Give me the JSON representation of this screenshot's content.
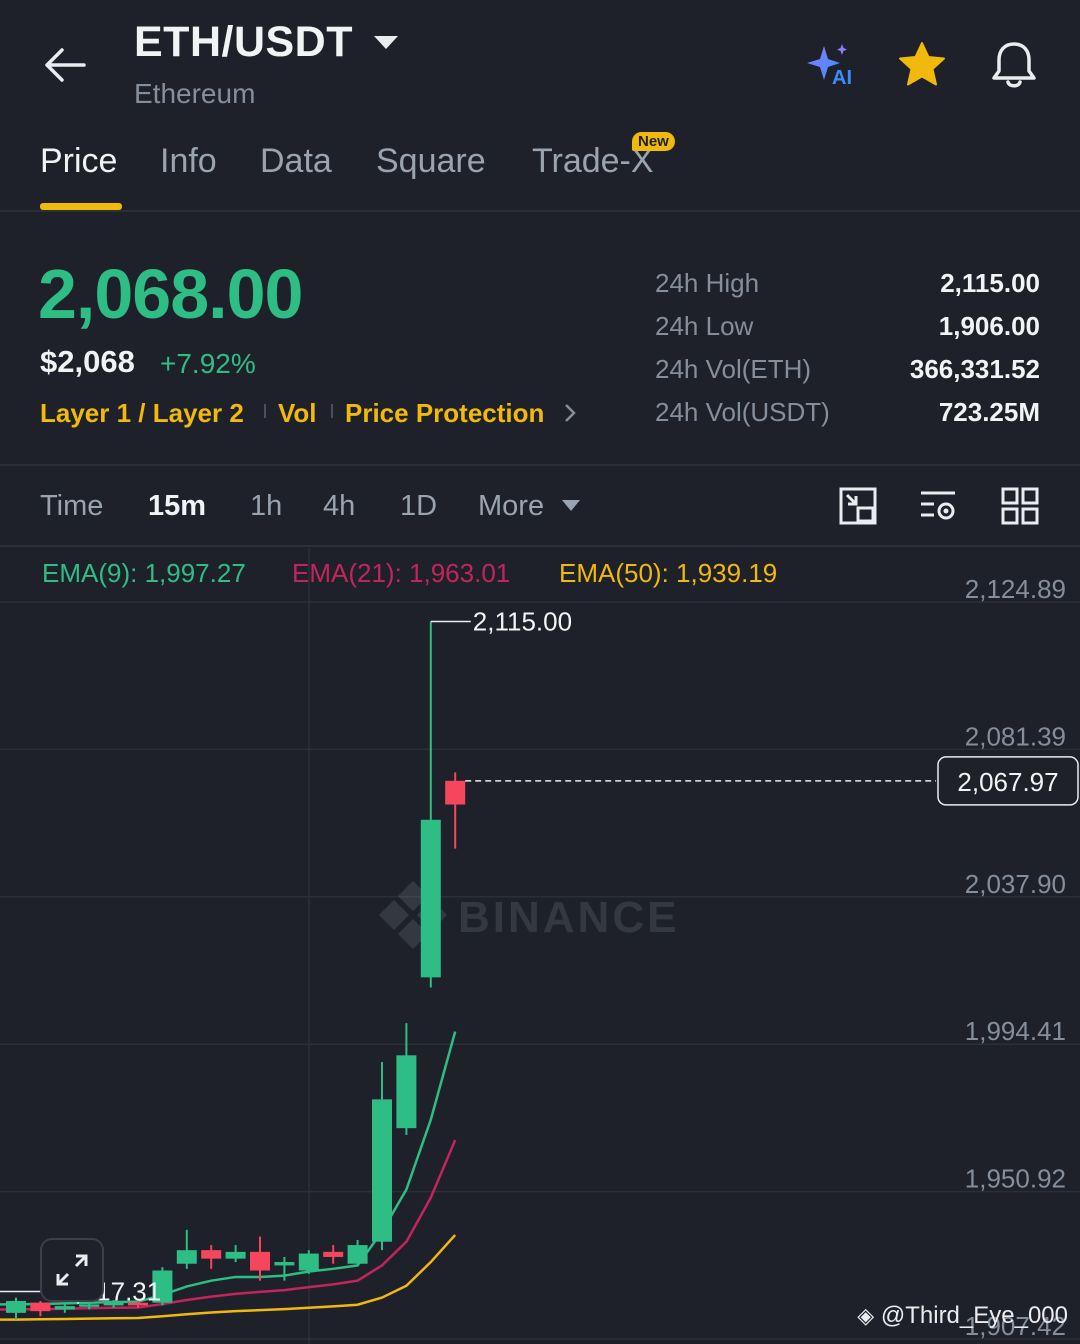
{
  "header": {
    "pair": "ETH/USDT",
    "name": "Ethereum"
  },
  "tabs": [
    {
      "label": "Price",
      "active": true
    },
    {
      "label": "Info"
    },
    {
      "label": "Data"
    },
    {
      "label": "Square"
    },
    {
      "label": "Trade-X",
      "badge": "New"
    }
  ],
  "price": {
    "last": "2,068.00",
    "usd": "$2,068",
    "change": "+7.92%",
    "tags": [
      "Layer 1 / Layer 2",
      "Vol",
      "Price Protection"
    ]
  },
  "stats": [
    {
      "label": "24h High",
      "value": "2,115.00"
    },
    {
      "label": "24h Low",
      "value": "1,906.00"
    },
    {
      "label": "24h Vol(ETH)",
      "value": "366,331.52"
    },
    {
      "label": "24h Vol(USDT)",
      "value": "723.25M"
    }
  ],
  "intervals": [
    "Time",
    "15m",
    "1h",
    "4h",
    "1D",
    "More"
  ],
  "active_interval": "15m",
  "ema": {
    "ema9": "EMA(9): 1,997.27",
    "ema21": "EMA(21): 1,963.01",
    "ema50": "EMA(50): 1,939.19"
  },
  "colors": {
    "up": "#2ebd85",
    "down": "#f6465d",
    "accent": "#f0b90b",
    "ema9": "#2ebd85",
    "ema21": "#c2255c",
    "ema50": "#f0b90b"
  },
  "watermark": "@Third_Eye_000",
  "chart_data": {
    "type": "candlestick",
    "y_ticks": [
      "2,124.89",
      "2,081.39",
      "2,037.90",
      "1,994.41",
      "1,950.92",
      "1,907.42"
    ],
    "ylim": [
      1907.42,
      2124.89
    ],
    "last_price_label": "2,067.97",
    "last_price": 2067.97,
    "high_marker": "2,115.00",
    "high_value": 2115.0,
    "low_marker": "1,917.31",
    "low_value": 1917.31,
    "candles": [
      {
        "o": 1911.0,
        "c": 1914.5,
        "h": 1915.5,
        "l": 1909.0
      },
      {
        "o": 1914.0,
        "c": 1911.5,
        "h": 1914.5,
        "l": 1910.0
      },
      {
        "o": 1912.0,
        "c": 1913.0,
        "h": 1914.0,
        "l": 1911.0
      },
      {
        "o": 1912.8,
        "c": 1913.5,
        "h": 1914.5,
        "l": 1912.0
      },
      {
        "o": 1913.2,
        "c": 1914.0,
        "h": 1914.8,
        "l": 1912.5
      },
      {
        "o": 1914.0,
        "c": 1913.2,
        "h": 1914.5,
        "l": 1912.5
      },
      {
        "o": 1914.0,
        "c": 1923.5,
        "h": 1924.5,
        "l": 1913.2
      },
      {
        "o": 1925.5,
        "c": 1929.5,
        "h": 1935.5,
        "l": 1924.0
      },
      {
        "o": 1929.5,
        "c": 1927.0,
        "h": 1931.0,
        "l": 1924.0
      },
      {
        "o": 1927.0,
        "c": 1929.0,
        "h": 1931.0,
        "l": 1926.0
      },
      {
        "o": 1929.0,
        "c": 1923.5,
        "h": 1933.5,
        "l": 1920.5
      },
      {
        "o": 1925.0,
        "c": 1926.0,
        "h": 1927.5,
        "l": 1920.5
      },
      {
        "o": 1923.5,
        "c": 1928.5,
        "h": 1929.5,
        "l": 1922.5
      },
      {
        "o": 1929.0,
        "c": 1927.5,
        "h": 1931.0,
        "l": 1925.5
      },
      {
        "o": 1925.5,
        "c": 1931.0,
        "h": 1932.5,
        "l": 1925.0
      },
      {
        "o": 1932.0,
        "c": 1974.0,
        "h": 1985.0,
        "l": 1929.5
      },
      {
        "o": 1965.5,
        "c": 1987.0,
        "h": 1996.5,
        "l": 1963.5
      },
      {
        "o": 2010.0,
        "c": 2056.5,
        "h": 2115.0,
        "l": 2007.0
      },
      {
        "o": 2068.0,
        "c": 2061.0,
        "h": 2070.5,
        "l": 2048.0
      }
    ],
    "ema9_line": [
      1913.5,
      1913.6,
      1913.8,
      1914.0,
      1914.2,
      1914.3,
      1916.3,
      1918.8,
      1920.5,
      1921.6,
      1921.6,
      1922.0,
      1923.2,
      1924.0,
      1925.0,
      1935.0,
      1947.4,
      1968.0,
      1994.0
    ],
    "ema21_line": [
      1912.0,
      1912.1,
      1912.2,
      1912.4,
      1912.5,
      1912.6,
      1913.6,
      1914.8,
      1915.8,
      1916.6,
      1917.2,
      1917.7,
      1918.6,
      1919.4,
      1920.5,
      1925.0,
      1932.0,
      1945.0,
      1962.0
    ],
    "ema50_line": [
      1909.0,
      1909.1,
      1909.2,
      1909.3,
      1909.4,
      1909.5,
      1910.0,
      1910.6,
      1911.1,
      1911.5,
      1911.8,
      1912.1,
      1912.5,
      1912.9,
      1913.4,
      1915.5,
      1919.0,
      1926.0,
      1934.0
    ]
  }
}
